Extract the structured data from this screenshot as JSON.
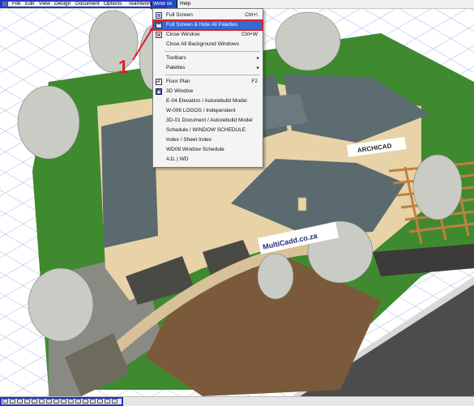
{
  "menubar": {
    "items": [
      {
        "label": "File"
      },
      {
        "label": "Edit"
      },
      {
        "label": "View"
      },
      {
        "label": "Design"
      },
      {
        "label": "Document"
      },
      {
        "label": "Options"
      },
      {
        "label": "Teamwork"
      },
      {
        "label": "Window",
        "active": true
      },
      {
        "label": "Help"
      }
    ]
  },
  "window_menu": {
    "items": [
      {
        "label": "Full Screen",
        "shortcut": "Ctrl+\\"
      },
      {
        "label": "Full Screen & Hide All Palettes",
        "shortcut": ""
      },
      {
        "label": "Close Window",
        "shortcut": "Ctrl+W"
      },
      {
        "label": "Close All Background Windows",
        "shortcut": ""
      },
      {
        "label": "Toolbars",
        "shortcut": ""
      },
      {
        "label": "Palettes",
        "shortcut": ""
      },
      {
        "label": "Floor Plan",
        "shortcut": "F2"
      },
      {
        "label": "3D Window",
        "shortcut": ""
      },
      {
        "label": "E-04 Elevation / Autorebuild Model",
        "shortcut": ""
      },
      {
        "label": "W-006 LOGOS / Independent",
        "shortcut": ""
      },
      {
        "label": "3D-01 Document / Autorebuild Model",
        "shortcut": ""
      },
      {
        "label": "Schedule / WINDOW SCHEDULE",
        "shortcut": ""
      },
      {
        "label": "Index / Sheet Index",
        "shortcut": ""
      },
      {
        "label": "WD08 Window Schedule",
        "shortcut": ""
      },
      {
        "label": "A1L | WD",
        "shortcut": ""
      }
    ]
  },
  "annotation": {
    "number": "1"
  },
  "scene": {
    "sign_left": "MultiCadd.co.za",
    "sign_right": "ARCHICAD"
  },
  "colors": {
    "accent": "#1f4fbf",
    "highlight_box": "#d9202a",
    "annotation": "#d71f28",
    "toolbar_box": "#2733c9",
    "roof": "#5a6a6e",
    "wall": "#e8d3a8"
  }
}
